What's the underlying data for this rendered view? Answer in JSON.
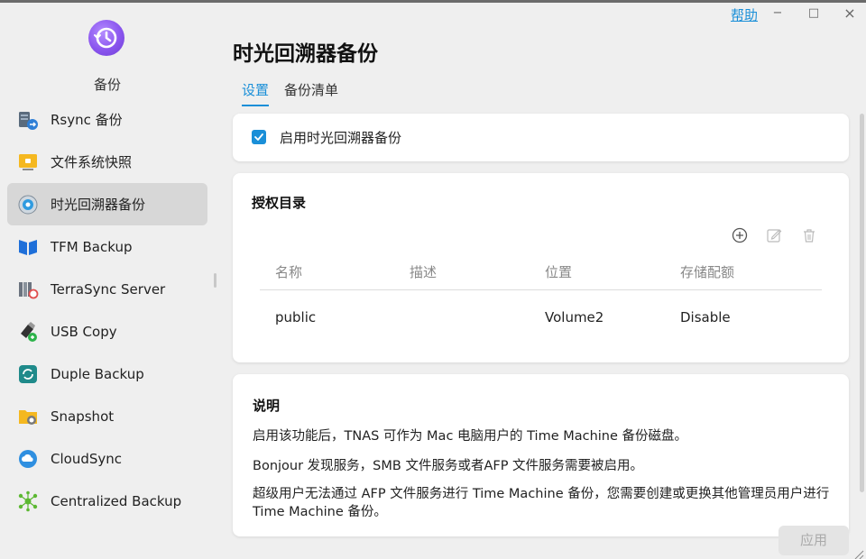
{
  "window": {
    "help": "帮助",
    "minimize": "−",
    "maximize": "□",
    "close": "×"
  },
  "sidebar": {
    "app_title": "备份",
    "items": [
      {
        "label": "Rsync 备份",
        "icon": "rsync-icon"
      },
      {
        "label": "文件系统快照",
        "icon": "snapshot-folder-icon"
      },
      {
        "label": "时光回溯器备份",
        "icon": "time-machine-icon"
      },
      {
        "label": "TFM Backup",
        "icon": "tfm-backup-icon"
      },
      {
        "label": "TerraSync Server",
        "icon": "terrasync-icon"
      },
      {
        "label": "USB Copy",
        "icon": "usb-copy-icon"
      },
      {
        "label": "Duple Backup",
        "icon": "duple-backup-icon"
      },
      {
        "label": "Snapshot",
        "icon": "snapshot-icon"
      },
      {
        "label": "CloudSync",
        "icon": "cloudsync-icon"
      },
      {
        "label": "Centralized Backup",
        "icon": "centralized-backup-icon"
      }
    ]
  },
  "main": {
    "title": "时光回溯器备份",
    "tabs": [
      {
        "label": "设置",
        "active": true
      },
      {
        "label": "备份清单",
        "active": false
      }
    ],
    "enable": {
      "label": "启用时光回溯器备份",
      "checked": true
    },
    "auth": {
      "title": "授权目录",
      "columns": [
        "名称",
        "描述",
        "位置",
        "存储配额"
      ],
      "rows": [
        [
          "public",
          "",
          "Volume2",
          "Disable"
        ]
      ]
    },
    "description": {
      "title": "说明",
      "lines": [
        "启用该功能后，TNAS 可作为 Mac 电脑用户的 Time Machine 备份磁盘。",
        "Bonjour 发现服务，SMB 文件服务或者AFP 文件服务需要被启用。",
        "超级用户无法通过 AFP 文件服务进行 Time Machine 备份，您需要创建或更换其他管理员用户进行 Time Machine 备份。"
      ]
    },
    "apply": "应用"
  },
  "colors": {
    "accent": "#1a8fd8",
    "sidebar_active": "#d7d7d7",
    "background": "#efefef"
  }
}
